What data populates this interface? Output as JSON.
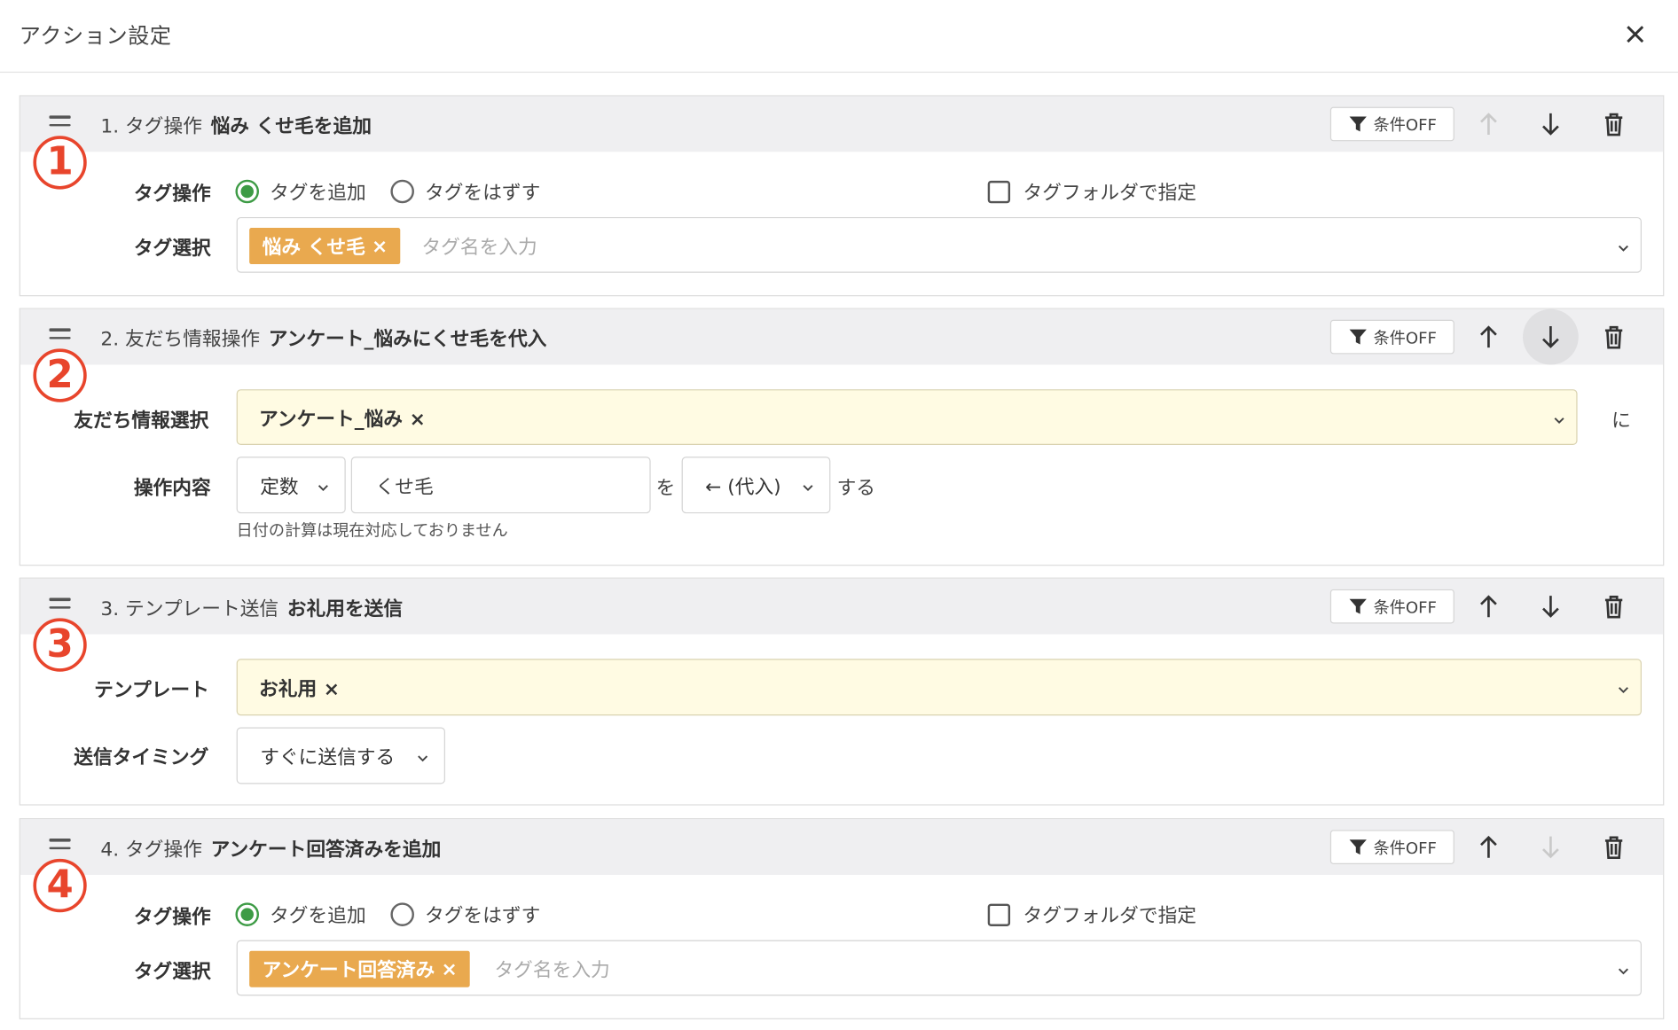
{
  "modal": {
    "title": "アクション設定"
  },
  "common": {
    "condition_label": "条件OFF",
    "tag_operation_label": "タグ操作",
    "tag_select_label": "タグ選択",
    "radio_add": "タグを追加",
    "radio_remove": "タグをはずす",
    "folder_check": "タグフォルダで指定",
    "tag_placeholder": "タグ名を入力",
    "chip_remove": "×"
  },
  "actions": [
    {
      "number": "1",
      "prefix": "1. タグ操作",
      "summary": "悩み くせ毛を追加",
      "tag_chip": "悩み くせ毛"
    },
    {
      "number": "2",
      "prefix": "2. 友だち情報操作",
      "summary": "アンケート_悩みにくせ毛を代入",
      "friend_info_label": "友だち情報選択",
      "friend_info_value": "アンケート_悩み",
      "suffix_ni": "に",
      "operation_label": "操作内容",
      "type_value": "定数",
      "input_value": "くせ毛",
      "wo": "を",
      "op_value": "← (代入)",
      "suru": "する",
      "hint": "日付の計算は現在対応しておりません"
    },
    {
      "number": "3",
      "prefix": "3. テンプレート送信",
      "summary": "お礼用を送信",
      "template_label": "テンプレート",
      "template_value": "お礼用",
      "timing_label": "送信タイミング",
      "timing_value": "すぐに送信する"
    },
    {
      "number": "4",
      "prefix": "4. タグ操作",
      "summary": "アンケート回答済みを追加",
      "tag_chip": "アンケート回答済み"
    }
  ]
}
